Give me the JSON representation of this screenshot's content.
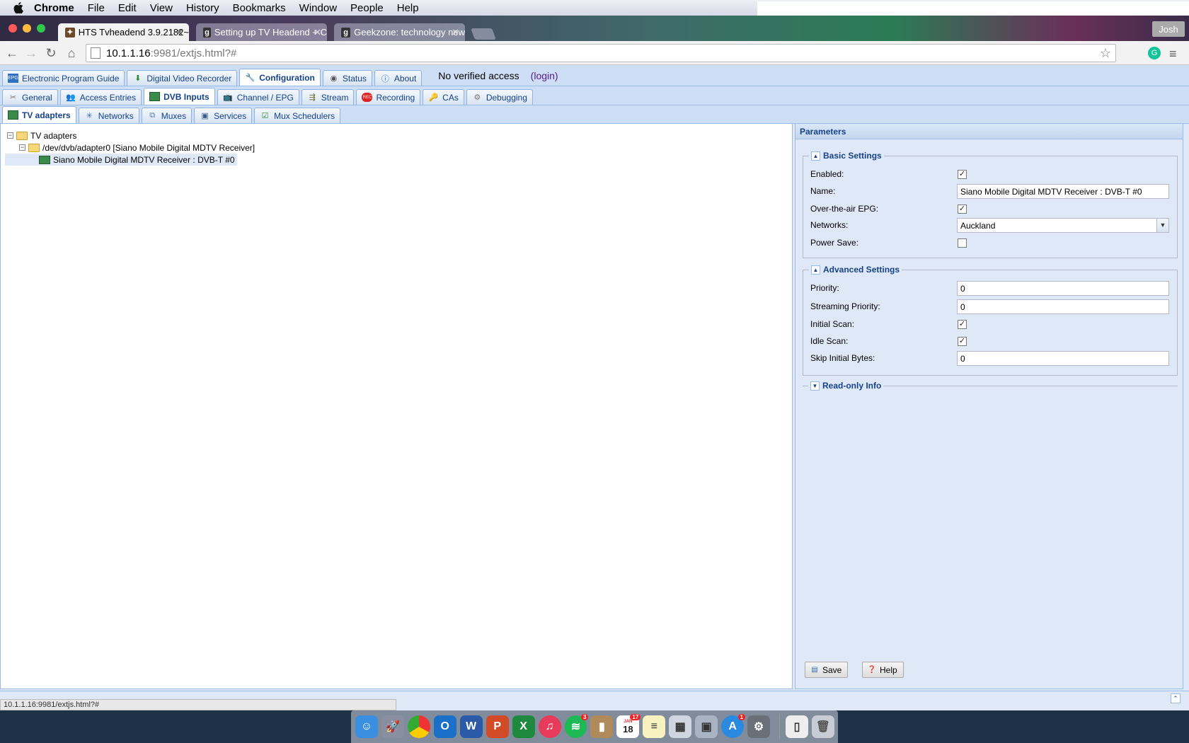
{
  "menubar": {
    "app_name": "Chrome",
    "items": [
      "File",
      "Edit",
      "View",
      "History",
      "Bookmarks",
      "Window",
      "People",
      "Help"
    ]
  },
  "browser": {
    "tabs": [
      {
        "title": "HTS Tvheadend 3.9.2182~",
        "active": true
      },
      {
        "title": "Setting up TV Headend + C",
        "active": false
      },
      {
        "title": "Geekzone: technology new",
        "active": false
      }
    ],
    "user": "Josh",
    "url_host": "10.1.1.16",
    "url_path": ":9981/extjs.html?#"
  },
  "app": {
    "top_tabs": [
      {
        "label": "Electronic Program Guide",
        "icon": "epg-icon"
      },
      {
        "label": "Digital Video Recorder",
        "icon": "download-icon"
      },
      {
        "label": "Configuration",
        "icon": "wrench-icon",
        "active": true
      },
      {
        "label": "Status",
        "icon": "eye-icon"
      },
      {
        "label": "About",
        "icon": "info-icon"
      }
    ],
    "access_text": "No verified access",
    "login_text": "(login)",
    "config_tabs": [
      {
        "label": "General",
        "icon": "tools-icon"
      },
      {
        "label": "Access Entries",
        "icon": "users-icon"
      },
      {
        "label": "DVB Inputs",
        "icon": "dvb-card-icon",
        "active": true
      },
      {
        "label": "Channel / EPG",
        "icon": "tv-icon"
      },
      {
        "label": "Stream",
        "icon": "stream-icon"
      },
      {
        "label": "Recording",
        "icon": "rec-icon"
      },
      {
        "label": "CAs",
        "icon": "key-icon"
      },
      {
        "label": "Debugging",
        "icon": "gears-icon"
      }
    ],
    "dvb_tabs": [
      {
        "label": "TV adapters",
        "icon": "dvb-card-icon",
        "active": true
      },
      {
        "label": "Networks",
        "icon": "antenna-icon"
      },
      {
        "label": "Muxes",
        "icon": "mux-icon"
      },
      {
        "label": "Services",
        "icon": "services-icon"
      },
      {
        "label": "Mux Schedulers",
        "icon": "scheduler-icon"
      }
    ]
  },
  "tree": {
    "root": "TV adapters",
    "adapter": "/dev/dvb/adapter0 [Siano Mobile Digital MDTV Receiver]",
    "frontend": "Siano Mobile Digital MDTV Receiver : DVB-T #0"
  },
  "params": {
    "title": "Parameters",
    "basic": {
      "legend": "Basic Settings",
      "enabled_label": "Enabled:",
      "enabled": true,
      "name_label": "Name:",
      "name_value": "Siano Mobile Digital MDTV Receiver : DVB-T #0",
      "epg_label": "Over-the-air EPG:",
      "epg": true,
      "networks_label": "Networks:",
      "networks_value": "Auckland",
      "power_label": "Power Save:",
      "power": false
    },
    "advanced": {
      "legend": "Advanced Settings",
      "priority_label": "Priority:",
      "priority_value": "0",
      "stream_priority_label": "Streaming Priority:",
      "stream_priority_value": "0",
      "initial_scan_label": "Initial Scan:",
      "initial_scan": true,
      "idle_scan_label": "Idle Scan:",
      "idle_scan": true,
      "skip_label": "Skip Initial Bytes:",
      "skip_value": "0"
    },
    "readonly_legend": "Read-only Info",
    "save_label": "Save",
    "help_label": "Help"
  },
  "status_url": "10.1.1.16:9981/extjs.html?#",
  "dock": {
    "calendar_day": "18",
    "calendar_month": "JAN",
    "badges": {
      "calendar": "17",
      "spotify": "3",
      "appstore": "1"
    }
  },
  "colors": {
    "ext_tab_text": "#15428b",
    "panel_bg": "#dfe8f6",
    "border": "#99bbe8"
  }
}
